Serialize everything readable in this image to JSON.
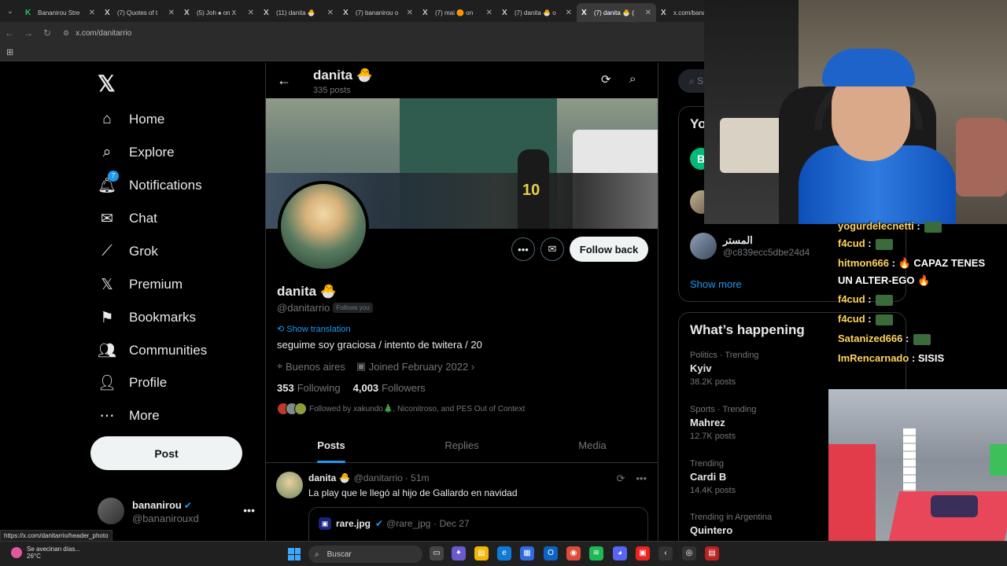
{
  "browser": {
    "tabs": [
      {
        "label": "Bananirou Stre",
        "fav": "K",
        "kind": "kick"
      },
      {
        "label": "(7) Quotes of t",
        "fav": "X",
        "kind": "x"
      },
      {
        "label": "(5) Joh ♠ on X",
        "fav": "X",
        "kind": "x"
      },
      {
        "label": "(11) danita 🐣",
        "fav": "X",
        "kind": "x"
      },
      {
        "label": "(7) bananirou o",
        "fav": "X",
        "kind": "x"
      },
      {
        "label": "(7) mai 🟠 on",
        "fav": "X",
        "kind": "x"
      },
      {
        "label": "(7) danita 🐣 o",
        "fav": "X",
        "kind": "x"
      },
      {
        "label": "(7) danita 🐣 (",
        "fav": "X",
        "kind": "x",
        "active": true
      },
      {
        "label": "x.com/bana",
        "fav": "X",
        "kind": "x"
      }
    ],
    "url": "x.com/danitarrio",
    "status_url": "https://x.com/danitarrio/header_photo"
  },
  "nav": {
    "logo": "𝕏",
    "items": [
      {
        "label": "Home",
        "icon": "⌂"
      },
      {
        "label": "Explore",
        "icon": "⌕"
      },
      {
        "label": "Notifications",
        "icon": "🔔︎",
        "badge": "7"
      },
      {
        "label": "Chat",
        "icon": "✉"
      },
      {
        "label": "Grok",
        "icon": "⟋"
      },
      {
        "label": "Premium",
        "icon": "𝕏"
      },
      {
        "label": "Bookmarks",
        "icon": "⚑"
      },
      {
        "label": "Communities",
        "icon": "👥︎"
      },
      {
        "label": "Profile",
        "icon": "👤︎"
      },
      {
        "label": "More",
        "icon": "⋯"
      }
    ],
    "post_label": "Post",
    "account": {
      "name": "bananirou",
      "handle": "@bananirouxd"
    }
  },
  "profile": {
    "header_name": "danita 🐣",
    "header_posts": "335 posts",
    "name": "danita 🐣",
    "handle": "@danitarrio",
    "follows_you": "Follows you",
    "show_translation": "Show translation",
    "bio": "seguime soy graciosa / intento de twitera / 20",
    "location": "Buenos aires",
    "joined": "Joined February 2022",
    "following_count": "353",
    "following_label": "Following",
    "followers_count": "4,003",
    "followers_label": "Followers",
    "followed_by": "Followed by xakundo🎄, Niconitroso, and PES Out of Context",
    "follow_back_label": "Follow back",
    "banner_shirt_number": "10"
  },
  "tabs": [
    "Posts",
    "Replies",
    "Media"
  ],
  "tweet": {
    "name": "danita 🐣",
    "handle": "@danitarrio",
    "time": "· 51m",
    "text": "La play que le llegó al hijo de Gallardo en navidad",
    "quote": {
      "name": "rare.jpg",
      "handle": "@rare_jpg",
      "date": "· Dec 27"
    }
  },
  "right": {
    "search_placeholder": "S",
    "who_to_follow_title": "Yo",
    "first_letter": "B",
    "suggested_user": {
      "name": "المستر",
      "handle": "@c839ecc5dbe24d4"
    },
    "show_more": "Show more",
    "happening_title": "What’s happening",
    "trends": [
      {
        "context": "Politics · Trending",
        "name": "Kyiv",
        "posts": "38.2K posts"
      },
      {
        "context": "Sports · Trending",
        "name": "Mahrez",
        "posts": "12.7K posts"
      },
      {
        "context": "Trending",
        "name": "Cardi B",
        "posts": "14.4K posts"
      },
      {
        "context": "Trending in Argentina",
        "name": "Quintero",
        "posts": ""
      }
    ]
  },
  "stream_chat": [
    {
      "user": "yogurdelecnetti",
      "msg": ":"
    },
    {
      "user": "f4cud",
      "msg": ":"
    },
    {
      "user": "hitmon666",
      "msg": ": 🔥 CAPAZ TENES"
    },
    {
      "user": "",
      "msg": "UN ALTER-EGO 🔥"
    },
    {
      "user": "f4cud",
      "msg": ":"
    },
    {
      "user": "f4cud",
      "msg": ":"
    },
    {
      "user": "Satanized666",
      "msg": ":"
    },
    {
      "user": "ImRencarnado",
      "msg": ": SISIS"
    }
  ],
  "taskbar": {
    "weather_text": "Se avecinan días...",
    "weather_temp": "26°C",
    "search_label": "Buscar"
  },
  "colors": {
    "accent": "#1d9bf0",
    "background": "#000000",
    "follow_button": "#eff3f4"
  }
}
